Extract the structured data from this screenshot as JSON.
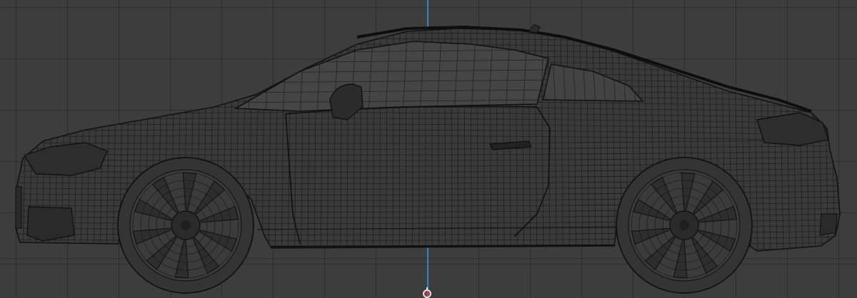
{
  "viewport": {
    "view": "side-orthographic",
    "shading": "wireframe",
    "background_color": "#3d3d3d",
    "grid_visible": true,
    "axis_color": "#3d8fd9",
    "wire_color": "#141414"
  },
  "model": {
    "subject": "coupe-car",
    "wheels": 2,
    "origin_visible": true
  }
}
